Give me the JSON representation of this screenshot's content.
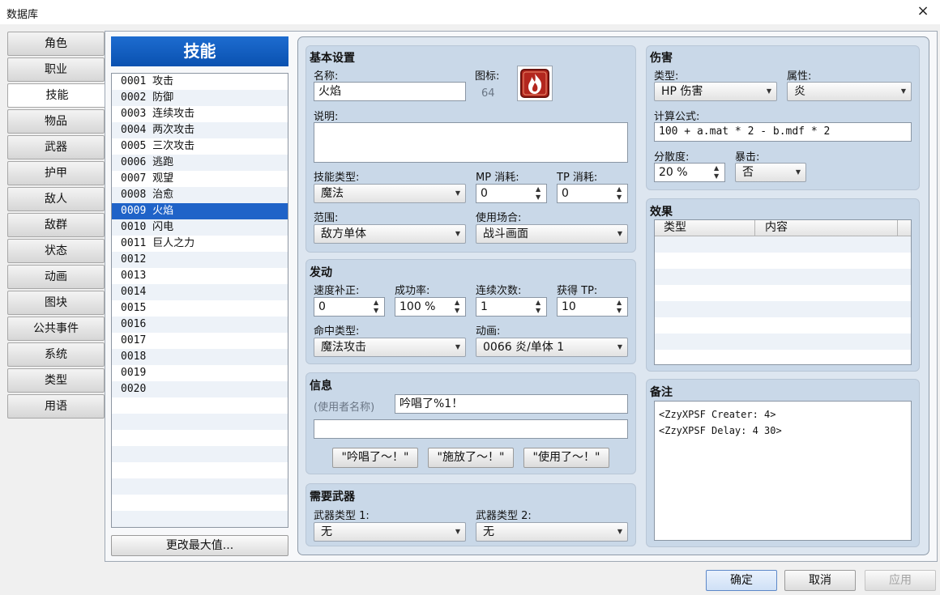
{
  "window": {
    "title": "数据库",
    "close": "×"
  },
  "tabs": [
    "角色",
    "职业",
    "技能",
    "物品",
    "武器",
    "护甲",
    "敌人",
    "敌群",
    "状态",
    "动画",
    "图块",
    "公共事件",
    "系统",
    "类型",
    "用语"
  ],
  "list": {
    "header": "技能",
    "items": [
      "0001 攻击",
      "0002 防御",
      "0003 连续攻击",
      "0004 两次攻击",
      "0005 三次攻击",
      "0006 逃跑",
      "0007 观望",
      "0008 治愈",
      "0009 火焰",
      "0010 闪电",
      "0011 巨人之力",
      "0012",
      "0013",
      "0014",
      "0015",
      "0016",
      "0017",
      "0018",
      "0019",
      "0020"
    ],
    "selected_index": 8,
    "change_max_button": "更改最大值..."
  },
  "basic": {
    "title": "基本设置",
    "name_label": "名称:",
    "name_value": "火焰",
    "icon_label": "图标:",
    "icon_index": "64",
    "desc_label": "说明:",
    "desc_value": "",
    "skill_type_label": "技能类型:",
    "skill_type_value": "魔法",
    "mp_label": "MP 消耗:",
    "mp_value": "0",
    "tp_label": "TP 消耗:",
    "tp_value": "0",
    "scope_label": "范围:",
    "scope_value": "敌方单体",
    "occasion_label": "使用场合:",
    "occasion_value": "战斗画面"
  },
  "invocation": {
    "title": "发动",
    "speed_label": "速度补正:",
    "speed_value": "0",
    "success_label": "成功率:",
    "success_value": "100 %",
    "repeat_label": "连续次数:",
    "repeat_value": "1",
    "tpgain_label": "获得 TP:",
    "tpgain_value": "10",
    "hit_type_label": "命中类型:",
    "hit_type_value": "魔法攻击",
    "animation_label": "动画:",
    "animation_value": "0066 炎/单体 1"
  },
  "message": {
    "title": "信息",
    "user_name_hint": "(使用者名称)",
    "line1": "吟唱了%1！",
    "line2": "",
    "btn1": "\"吟唱了～！\"",
    "btn2": "\"施放了～！\"",
    "btn3": "\"使用了～！\""
  },
  "weapon": {
    "title": "需要武器",
    "type1_label": "武器类型 1:",
    "type1_value": "无",
    "type2_label": "武器类型 2:",
    "type2_value": "无"
  },
  "damage": {
    "title": "伤害",
    "type_label": "类型:",
    "type_value": "HP 伤害",
    "element_label": "属性:",
    "element_value": "炎",
    "formula_label": "计算公式:",
    "formula_value": "100 + a.mat * 2 - b.mdf * 2",
    "variance_label": "分散度:",
    "variance_value": "20 %",
    "critical_label": "暴击:",
    "critical_value": "否"
  },
  "effects": {
    "title": "效果",
    "col_type": "类型",
    "col_content": "内容"
  },
  "notes": {
    "title": "备注",
    "lines": [
      "<ZzyXPSF Creater: 4>",
      "<ZzyXPSF Delay: 4 30>"
    ]
  },
  "footer": {
    "ok": "确定",
    "cancel": "取消",
    "apply": "应用"
  },
  "colors": {
    "accent": "#0a51b0",
    "selection": "#1f63c8",
    "panel": "#c9d8e8"
  },
  "icons": [
    "close-icon",
    "fire-skill-icon",
    "dropdown-arrow-icon",
    "spinner-arrows-icon"
  ]
}
